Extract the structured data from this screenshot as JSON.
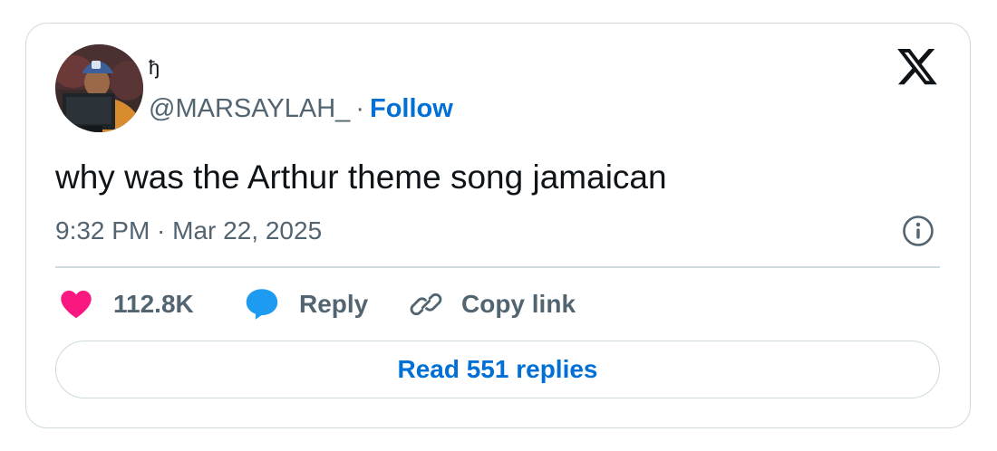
{
  "tweet": {
    "author": {
      "display_name": "ђ",
      "handle": "@MARSAYLAH_",
      "separator": "·",
      "follow_label": "Follow"
    },
    "text": "why was the Arthur theme song jamaican",
    "timestamp": "9:32 PM · Mar 22, 2025"
  },
  "actions": {
    "like_count": "112.8K",
    "reply_label": "Reply",
    "copy_link_label": "Copy link",
    "read_replies_label": "Read 551 replies"
  },
  "icons": {
    "logo": "x-logo-icon",
    "info": "info-icon",
    "like": "heart-icon",
    "reply": "speech-bubble-icon",
    "copy": "link-icon"
  },
  "colors": {
    "accent_blue": "#006fd6",
    "like_pink": "#f91880",
    "reply_blue": "#1d9bf0",
    "text_primary": "#0f1419",
    "text_secondary": "#536471",
    "border": "#cfd9de"
  }
}
